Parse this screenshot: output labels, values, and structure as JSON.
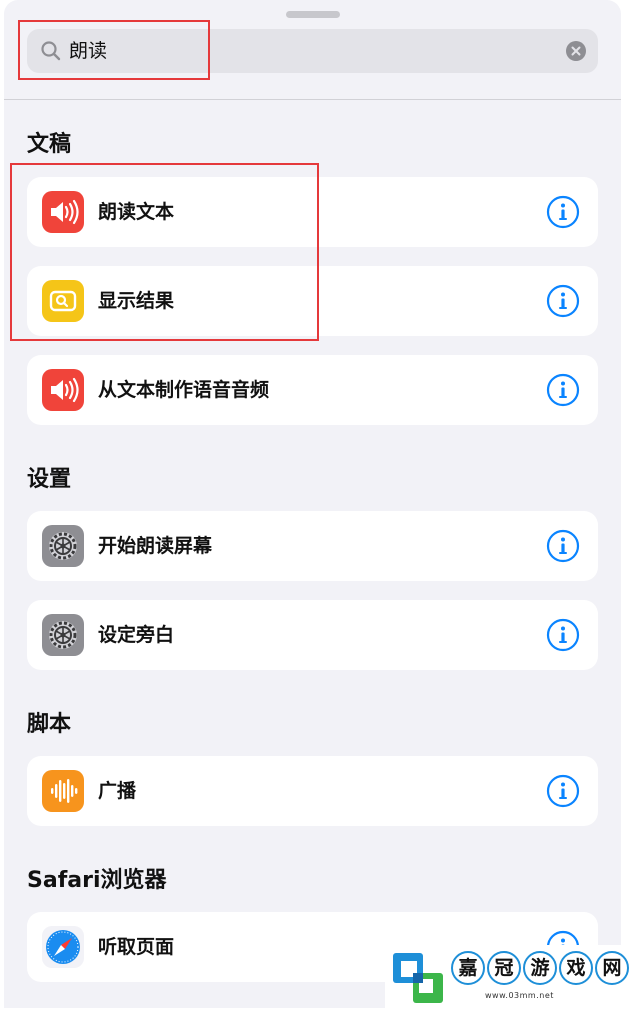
{
  "search": {
    "query": "朗读"
  },
  "sections": [
    {
      "title": "文稿",
      "items": [
        {
          "label": "朗读文本",
          "icon": "speaker-icon",
          "color": "#f0443a"
        },
        {
          "label": "显示结果",
          "icon": "quick-look-icon",
          "color": "#f5c518"
        },
        {
          "label": "从文本制作语音音频",
          "icon": "speaker-icon",
          "color": "#f0443a"
        }
      ]
    },
    {
      "title": "设置",
      "items": [
        {
          "label": "开始朗读屏幕",
          "icon": "settings-gear-icon",
          "color": "#8e8e93"
        },
        {
          "label": "设定旁白",
          "icon": "settings-gear-icon",
          "color": "#8e8e93"
        }
      ]
    },
    {
      "title": "脚本",
      "items": [
        {
          "label": "广播",
          "icon": "waveform-icon",
          "color": "#f7941d"
        }
      ]
    },
    {
      "title": "Safari浏览器",
      "items": [
        {
          "label": "听取页面",
          "icon": "safari-compass-icon",
          "color": "#1a8cf0"
        }
      ]
    }
  ],
  "colors": {
    "accent": "#0a84ff",
    "highlight": "#e5393b",
    "background": "#f2f2f7"
  },
  "watermark": {
    "chars": [
      "嘉",
      "冠",
      "游",
      "戏",
      "网"
    ],
    "url": "www.03mm.net"
  }
}
